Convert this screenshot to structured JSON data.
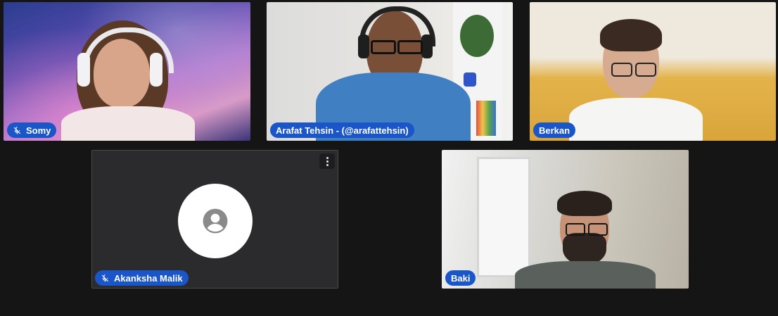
{
  "participants": [
    {
      "name": "Somy",
      "muted": true
    },
    {
      "name": "Arafat Tehsin - (@arafattehsin)",
      "muted": false
    },
    {
      "name": "Berkan",
      "muted": false
    },
    {
      "name": "Akanksha Malik",
      "muted": true
    },
    {
      "name": "Baki",
      "muted": false
    }
  ],
  "colors": {
    "background": "#151515",
    "badge": "#1a56c8",
    "badge_text": "#ffffff",
    "no_video_tile": "#2b2b2d",
    "avatar_fill": "#ffffff",
    "avatar_icon": "#8a8a8a"
  },
  "icons": {
    "muted": "mic-off-icon",
    "avatar": "user-circle-icon",
    "menu": "more-vertical-icon"
  }
}
